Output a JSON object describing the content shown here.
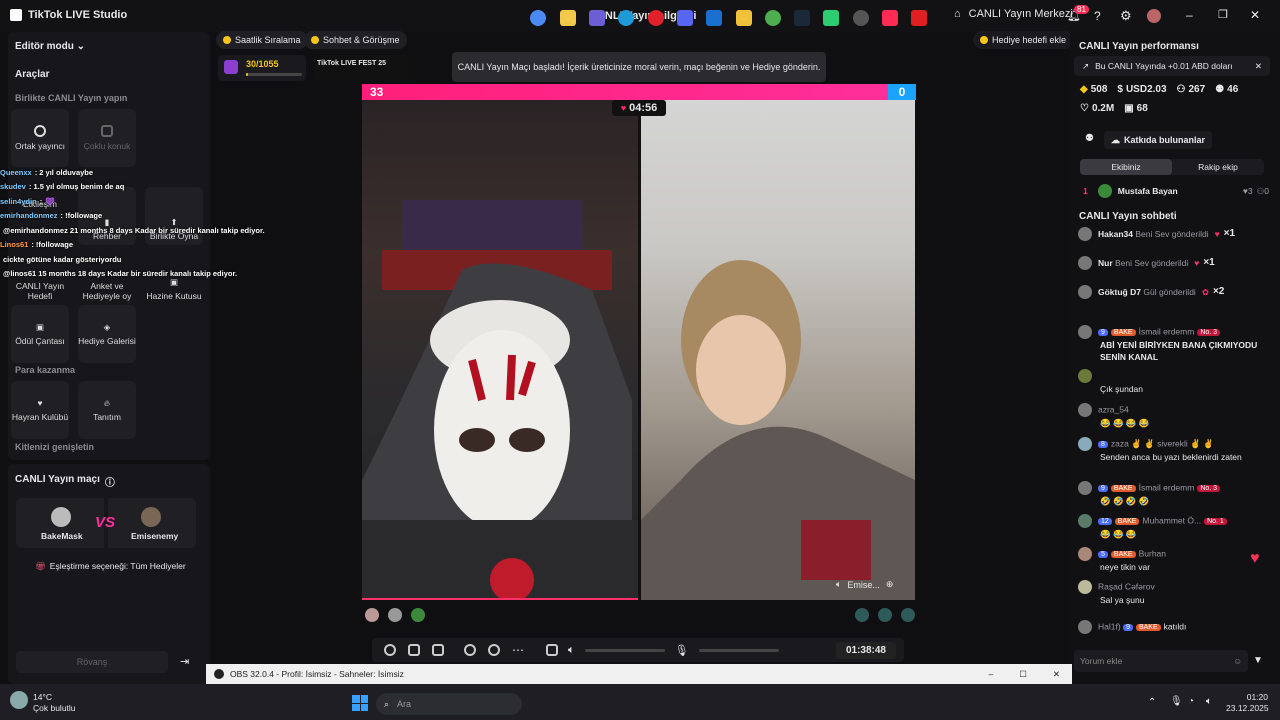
{
  "titlebar": {
    "app_name": "TikTok LIVE Studio",
    "center_title": "CANLI Yayın bilgileri",
    "live_center": "CANLI Yayın Merkezi",
    "notif_count": "81"
  },
  "left": {
    "editor_mode": "Editör modu",
    "tools_title": "Araçlar",
    "collab_label": "Birlikte CANLI Yayın yapın",
    "tools_row1": [
      "Ortak yayıncı",
      "Çoklu konuk"
    ],
    "tools_row2": [
      "Etkileşim",
      "Rehber",
      "Birlikte Oyna"
    ],
    "tools_row3": [
      "CANLI Yayın Hedefi",
      "Anket ve Hediyeyle oy",
      "Hazine Kutusu"
    ],
    "tools_row4": [
      "Ödül Çantası",
      "Hediye Galerisi"
    ],
    "earn_label": "Para kazanma",
    "earn_tools": [
      "Hayran Kulübü",
      "Tanıtım"
    ],
    "expand_label": "Kitlenizi genişletin",
    "match_title": "CANLI Yayın maçı",
    "player1": "BakeMask",
    "vs": "VS",
    "player2": "Emisenemy",
    "pairing": "Eşleştirme seçeneği: Tüm Hediyeler",
    "rematch": "Rövanş"
  },
  "overlay_chat": [
    {
      "name": "Queenxx",
      "text": ": 2 yıl olduvaybe"
    },
    {
      "name": "skudev",
      "text": ": 1.5 yıl olmuş benim de aq"
    },
    {
      "name": "selin4ydin",
      "text": ":"
    },
    {
      "name": "emirhandonmez",
      "text": ": !followage"
    },
    {
      "name": "",
      "text": "@emirhandonmez 21 months 8 days Kadar bir süredir kanalı takip ediyor."
    },
    {
      "name": "Linos61",
      "text": ": !followage"
    },
    {
      "name": "",
      "text": "cickte götüne kadar gösteriyordu"
    },
    {
      "name": "",
      "text": "@linos61 15 months 18 days Kadar bir süredir kanalı takip ediyor."
    }
  ],
  "stage": {
    "btn_hourly": "Saatlik Sıralama",
    "btn_chat": "Sohbet & Görüşme",
    "progress_text": "30/1055",
    "progress_fraction": 0.03,
    "event_label": "TikTok LIVE FEST 25",
    "notice": "CANLI Yayın Maçı başladı! İçerik üreticinize moral verin, maçı beğenin ve Hediye gönderin.",
    "gift_goal": "Hediye hedefi ekle",
    "score_left": "33",
    "score_right": "0",
    "timer": "04:56",
    "right_name": "Emise...",
    "duration": "01:38:48"
  },
  "right": {
    "perf_title": "CANLI Yayın performansı",
    "perf_banner": "Bu CANLI Yayında +0.01 ABD doları",
    "stats": [
      "508",
      "USD2.03",
      "267",
      "46",
      "0.2M",
      "68"
    ],
    "contributors": "Katkıda bulunanlar",
    "tab_team": "Ekibiniz",
    "tab_rival": "Rakip ekip",
    "top_rank": "1",
    "top_name": "Mustafa Bayan",
    "top_likes": "3",
    "top_gifts": "0",
    "chat_title": "CANLI Yayın sohbeti",
    "gifts": [
      {
        "name": "Hakan34",
        "text": "Beni Sev gönderildi",
        "count": "×1"
      },
      {
        "name": "Nur",
        "text": "Beni Sev gönderildi",
        "count": "×1"
      },
      {
        "name": "Göktuğ D7",
        "text": "Gül gönderildi",
        "count": "×2"
      }
    ],
    "comments": [
      {
        "level": "9",
        "bake": "BAKE",
        "name": "İsmail erdemm",
        "rank": "No. 3",
        "text": "ABİ YENİ BİRİYKEN BANA ÇIKMIYODU SENİN KANAL"
      },
      {
        "level": "",
        "bake": "",
        "name": "",
        "rank": "",
        "text": "Çık şundan"
      },
      {
        "level": "",
        "bake": "",
        "name": "azra_54",
        "rank": "",
        "text": "😂 😂 😂 😂"
      },
      {
        "level": "8",
        "bake": "",
        "name": "zaza ✌ ✌ siverekli ✌ ✌",
        "rank": "",
        "text": "Senden anca bu yazı beklenirdi zaten"
      },
      {
        "level": "9",
        "bake": "BAKE",
        "name": "İsmail erdemm",
        "rank": "No. 3",
        "text": "🤣 🤣 🤣 🤣"
      },
      {
        "level": "12",
        "bake": "BAKE",
        "name": "Muhammet Ö...",
        "rank": "No. 1",
        "text": "😂 😂 😂"
      },
      {
        "level": "5",
        "bake": "BAKE",
        "name": "Burhan",
        "rank": "",
        "text": "neye tikin var"
      },
      {
        "level": "",
        "bake": "",
        "name": "Raşad Cəfərov",
        "rank": "",
        "text": "Sal ya şunu"
      },
      {
        "level": "9",
        "bake": "BAKE",
        "name": "Hal1f)",
        "rank": "",
        "text": "katıldı"
      }
    ],
    "comment_placeholder": "Yorum ekle"
  },
  "obs": {
    "title": "OBS 32.0.4 - Profil: İsimsiz - Sahneler: İsimsiz"
  },
  "taskbar": {
    "temp": "14°C",
    "weather": "Çok bulutlu",
    "search": "Ara",
    "time": "01:20",
    "date": "23.12.2025"
  },
  "colors": {
    "accent": "#fe2c55",
    "blue": "#1aa3ff",
    "panel": "#17171b"
  }
}
